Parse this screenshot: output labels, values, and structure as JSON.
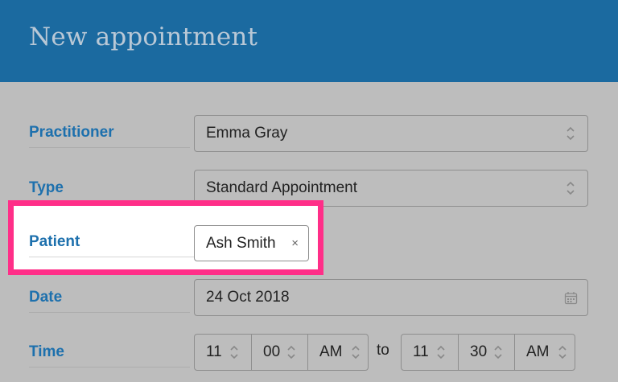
{
  "header": {
    "title": "New appointment"
  },
  "form": {
    "practitioner": {
      "label": "Practitioner",
      "value": "Emma Gray"
    },
    "type": {
      "label": "Type",
      "value": "Standard Appointment"
    },
    "patient": {
      "label": "Patient",
      "chip": "Ash Smith",
      "remove": "×"
    },
    "date": {
      "label": "Date",
      "value": "24 Oct 2018"
    },
    "time": {
      "label": "Time",
      "start_hour": "11",
      "start_minute": "00",
      "start_ampm": "AM",
      "separator": "to",
      "end_hour": "11",
      "end_minute": "30",
      "end_ampm": "AM"
    }
  },
  "colors": {
    "header_bg": "#1b6aa0",
    "label_text": "#1d70ad",
    "highlight_border": "#ff2e88",
    "overlay_bg": "#bdbdbd"
  },
  "icons": [
    "chevron-updown-icon",
    "calendar-icon",
    "close-icon"
  ]
}
